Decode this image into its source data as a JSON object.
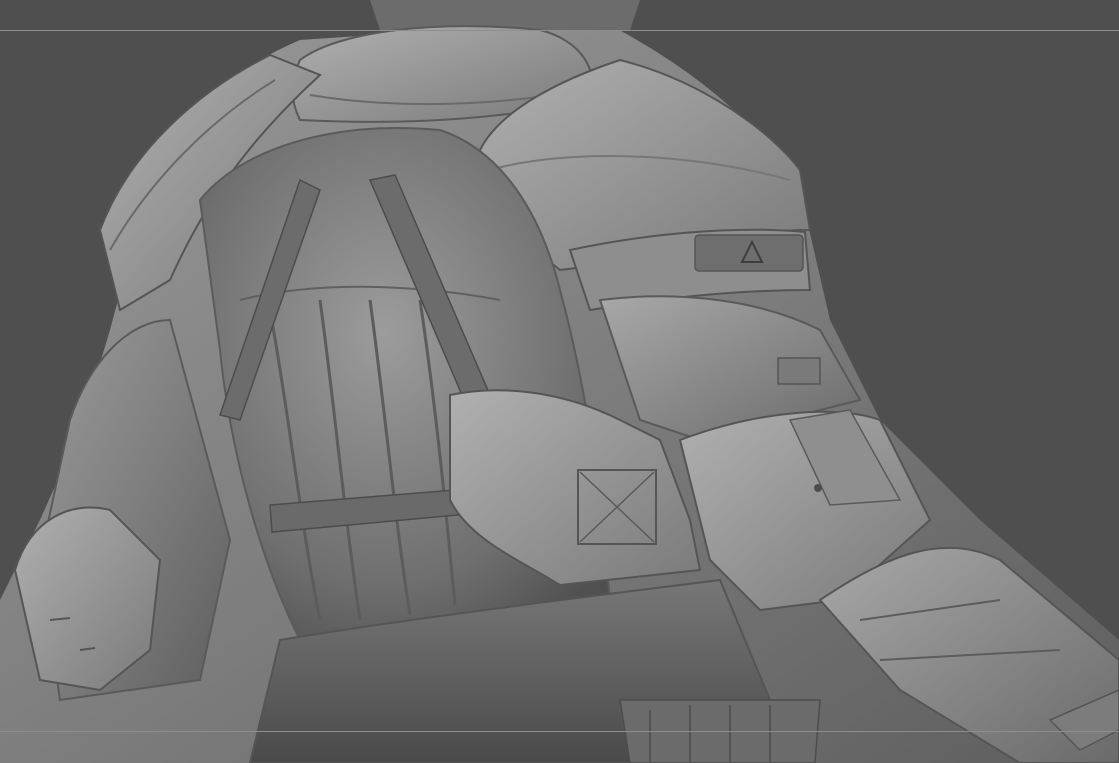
{
  "app": {
    "name": "",
    "canvas_background": "#4f4f4f"
  },
  "viewport": {
    "mode": "3d-sculpt-view",
    "subject": "armored-character-back-and-right-arm",
    "material_color": "#8a8a8a",
    "guide_lines": 2
  },
  "emblem": {
    "icon": "triangle-logo-icon"
  }
}
